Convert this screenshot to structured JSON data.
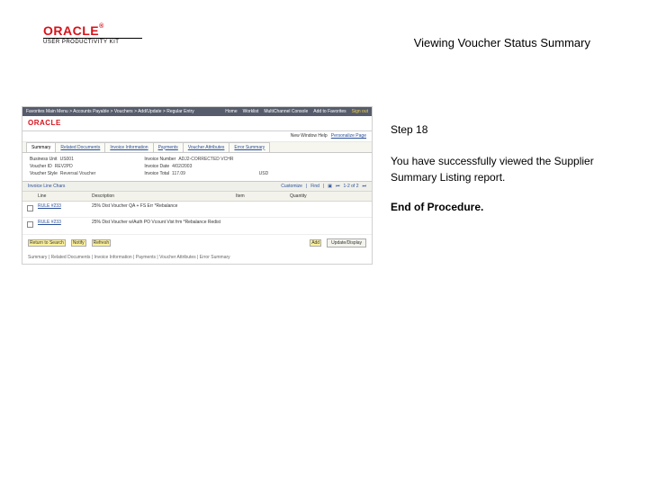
{
  "logo": {
    "brand": "ORACLE",
    "reg": "®",
    "subtitle": "USER PRODUCTIVITY KIT"
  },
  "title": "Viewing Voucher Status Summary",
  "instruction": {
    "step": "Step 18",
    "body": "You have successfully viewed the Supplier Summary Listing report.",
    "end": "End of Procedure."
  },
  "app": {
    "topbar": {
      "breadcrumb": "Favorites    Main Menu > Accounts Payable > Vouchers > Add/Update > Regular Entry",
      "links": [
        "Home",
        "Worklist",
        "MultiChannel Console",
        "Add to Favorites",
        "Sign out"
      ]
    },
    "logorow": {
      "brand": "ORACLE"
    },
    "subheader": {
      "left": "New Window   Help",
      "link": "Personalize Page"
    },
    "tabs": [
      "Summary",
      "Related Documents",
      "Invoice Information",
      "Payments",
      "Voucher Attributes",
      "Error Summary"
    ],
    "form": {
      "bu": {
        "label": "Business Unit",
        "value": "US001"
      },
      "invno": {
        "label": "Invoice Number",
        "value": "ADJ2-CORRECTED VCHR"
      },
      "vid": {
        "label": "Voucher ID",
        "value": "REV2PD"
      },
      "invdate": {
        "label": "Invoice Date",
        "value": "4/02/2003"
      },
      "style": {
        "label": "Voucher Style",
        "value": "Reversal Voucher"
      },
      "total": {
        "label": "Invoice Total",
        "value": "117.09"
      },
      "currency": "USD"
    },
    "section": {
      "title": "Invoice Line Chars",
      "customize": "Customize",
      "find": "Find",
      "range": "1-2 of 2"
    },
    "grid": {
      "headers": [
        "Line",
        "Description",
        "Item",
        "Quantity"
      ],
      "rows": [
        {
          "c0": "RULE #233",
          "c1": "25% Dist Voucher QA + FS Err *Rebalance",
          "c2": "",
          "c3": ""
        },
        {
          "c0": "RULE #233",
          "c1": "25% Dist Voucher w/Auth PO Vcount Vist frm *Rebalance Redist",
          "c2": "",
          "c3": ""
        }
      ]
    },
    "buttons": [
      "Return to Search",
      "Notify",
      "Refresh",
      "Add",
      "Update/Display"
    ],
    "footnote": "Summary | Related Documents | Invoice Information | Payments | Voucher Attributes | Error Summary"
  }
}
